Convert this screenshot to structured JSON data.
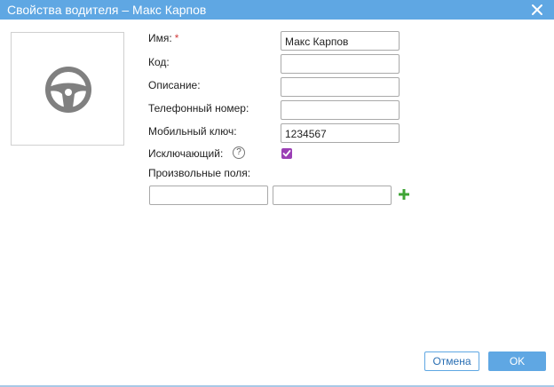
{
  "dialog": {
    "title": "Свойства водителя – Макс Карпов",
    "close_icon": "close-icon",
    "colors": {
      "header": "#5fa7e3",
      "checkbox": "#9b3fb5",
      "add": "#3fa435",
      "required": "#d23c3c"
    }
  },
  "photo": {
    "icon": "steering-wheel-icon"
  },
  "form": {
    "name_label": "Имя:",
    "required_mark": "*",
    "name_value": "Макс Карпов",
    "code_label": "Код:",
    "code_value": "",
    "description_label": "Описание:",
    "description_value": "",
    "phone_label": "Телефонный номер:",
    "phone_value": "",
    "mobile_key_label": "Мобильный ключ:",
    "mobile_key_value": "1234567",
    "exclusive_label": "Исключающий:",
    "exclusive_help": "?",
    "exclusive_checked": true,
    "custom_fields_label": "Произвольные поля:",
    "custom_field_name": "",
    "custom_field_value": "",
    "add_icon": "plus-icon"
  },
  "buttons": {
    "cancel": "Отмена",
    "ok": "OK"
  }
}
